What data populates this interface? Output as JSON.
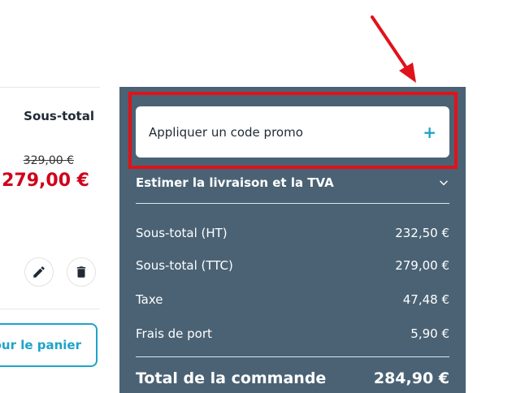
{
  "cart_item": {
    "subtotal_heading": "Sous-total",
    "old_price": "329,00 €",
    "new_price": "279,00 €",
    "edit_icon": "pencil-icon",
    "delete_icon": "trash-icon",
    "update_cart_label": "jour le panier"
  },
  "summary": {
    "promo_label": "Appliquer un code promo",
    "promo_icon": "+",
    "estimate_label": "Estimer la livraison et la TVA",
    "estimate_icon": "chevron-down-icon",
    "rows": [
      {
        "label": "Sous-total (HT)",
        "value": "232,50 €"
      },
      {
        "label": "Sous-total (TTC)",
        "value": "279,00 €"
      },
      {
        "label": "Taxe",
        "value": "47,48 €"
      },
      {
        "label": "Frais de port",
        "value": "5,90 €"
      }
    ],
    "total_label": "Total de la commande",
    "total_value": "284,90 €"
  },
  "colors": {
    "panel": "#4a6274",
    "accent": "#1fa3c9",
    "price_red": "#d0021b",
    "annotation_red": "#e0121a"
  }
}
